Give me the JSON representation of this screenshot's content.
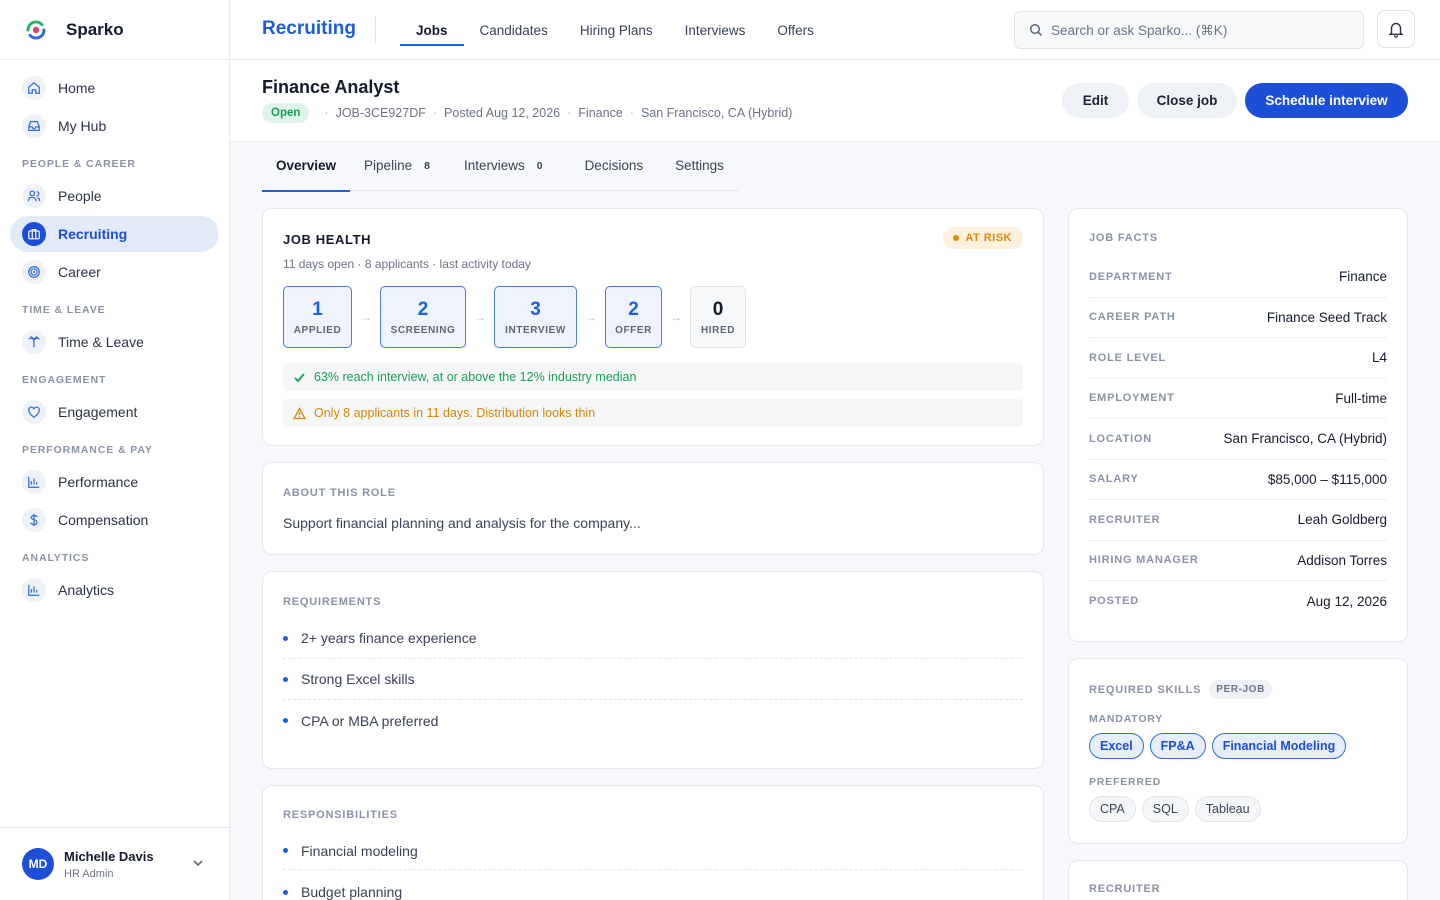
{
  "brand": {
    "name": "Sparko"
  },
  "sidebar": {
    "items_top": [
      {
        "label": "Home",
        "icon": "home-icon"
      },
      {
        "label": "My Hub",
        "icon": "inbox-icon"
      }
    ],
    "sections": [
      {
        "title": "PEOPLE & CAREER",
        "items": [
          {
            "label": "People",
            "icon": "users-icon"
          },
          {
            "label": "Recruiting",
            "icon": "briefcase-icon",
            "active": true
          },
          {
            "label": "Career",
            "icon": "target-icon"
          }
        ]
      },
      {
        "title": "TIME & LEAVE",
        "items": [
          {
            "label": "Time & Leave",
            "icon": "palm-tree-icon"
          }
        ]
      },
      {
        "title": "ENGAGEMENT",
        "items": [
          {
            "label": "Engagement",
            "icon": "heart-icon"
          }
        ]
      },
      {
        "title": "PERFORMANCE & PAY",
        "items": [
          {
            "label": "Performance",
            "icon": "bar-chart-icon"
          },
          {
            "label": "Compensation",
            "icon": "dollar-icon"
          }
        ]
      },
      {
        "title": "ANALYTICS",
        "items": [
          {
            "label": "Analytics",
            "icon": "bar-chart-icon"
          }
        ]
      }
    ],
    "user": {
      "initials": "MD",
      "name": "Michelle Davis",
      "role": "HR Admin"
    }
  },
  "topbar": {
    "title": "Recruiting",
    "tabs": [
      "Jobs",
      "Candidates",
      "Hiring Plans",
      "Interviews",
      "Offers"
    ],
    "active_tab": "Jobs",
    "search_placeholder": "Search or ask Sparko... (⌘K)"
  },
  "job": {
    "title": "Finance Analyst",
    "status": "Open",
    "id": "JOB-3CE927DF",
    "posted": "Posted Aug 12, 2026",
    "department": "Finance",
    "location": "San Francisco, CA (Hybrid)",
    "actions": {
      "edit": "Edit",
      "close": "Close job",
      "schedule": "Schedule interview"
    }
  },
  "content_tabs": [
    {
      "label": "Overview",
      "count": ""
    },
    {
      "label": "Pipeline",
      "count": "8"
    },
    {
      "label": "Interviews",
      "count": "0"
    },
    {
      "label": "Decisions",
      "count": ""
    },
    {
      "label": "Settings",
      "count": ""
    }
  ],
  "health": {
    "title": "JOB HEALTH",
    "badge": "AT RISK",
    "subtitle": "11 days open · 8 applicants · last activity today",
    "stages": [
      {
        "value": "1",
        "label": "APPLIED"
      },
      {
        "value": "2",
        "label": "SCREENING"
      },
      {
        "value": "3",
        "label": "INTERVIEW"
      },
      {
        "value": "2",
        "label": "OFFER"
      },
      {
        "value": "0",
        "label": "HIRED"
      }
    ],
    "note_ok": "63% reach interview, at or above the 12% industry median",
    "note_warn": "Only 8 applicants in 11 days. Distribution looks thin"
  },
  "about": {
    "title": "ABOUT THIS ROLE",
    "text": "Support financial planning and analysis for the company..."
  },
  "requirements": {
    "title": "REQUIREMENTS",
    "items": [
      "2+ years finance experience",
      "Strong Excel skills",
      "CPA or MBA preferred"
    ]
  },
  "responsibilities": {
    "title": "RESPONSIBILITIES",
    "items": [
      "Financial modeling",
      "Budget planning"
    ]
  },
  "facts": {
    "title": "JOB FACTS",
    "rows": [
      {
        "k": "DEPARTMENT",
        "v": "Finance"
      },
      {
        "k": "CAREER PATH",
        "v": "Finance Seed Track"
      },
      {
        "k": "ROLE LEVEL",
        "v": "L4"
      },
      {
        "k": "EMPLOYMENT",
        "v": "Full-time"
      },
      {
        "k": "LOCATION",
        "v": "San Francisco, CA (Hybrid)"
      },
      {
        "k": "SALARY",
        "v": "$85,000 – $115,000"
      },
      {
        "k": "RECRUITER",
        "v": "Leah Goldberg"
      },
      {
        "k": "HIRING MANAGER",
        "v": "Addison Torres"
      },
      {
        "k": "POSTED",
        "v": "Aug 12, 2026"
      }
    ]
  },
  "skills": {
    "title": "REQUIRED SKILLS",
    "tag": "PER-JOB",
    "mandatory_label": "MANDATORY",
    "mandatory": [
      "Excel",
      "FP&A",
      "Financial Modeling"
    ],
    "preferred_label": "PREFERRED",
    "preferred": [
      "CPA",
      "SQL",
      "Tableau"
    ]
  },
  "recruiter_card": {
    "title": "RECRUITER"
  },
  "colors": {
    "accent": "#1d4ed8",
    "success": "#16a05b",
    "warning": "#e08b0a"
  }
}
